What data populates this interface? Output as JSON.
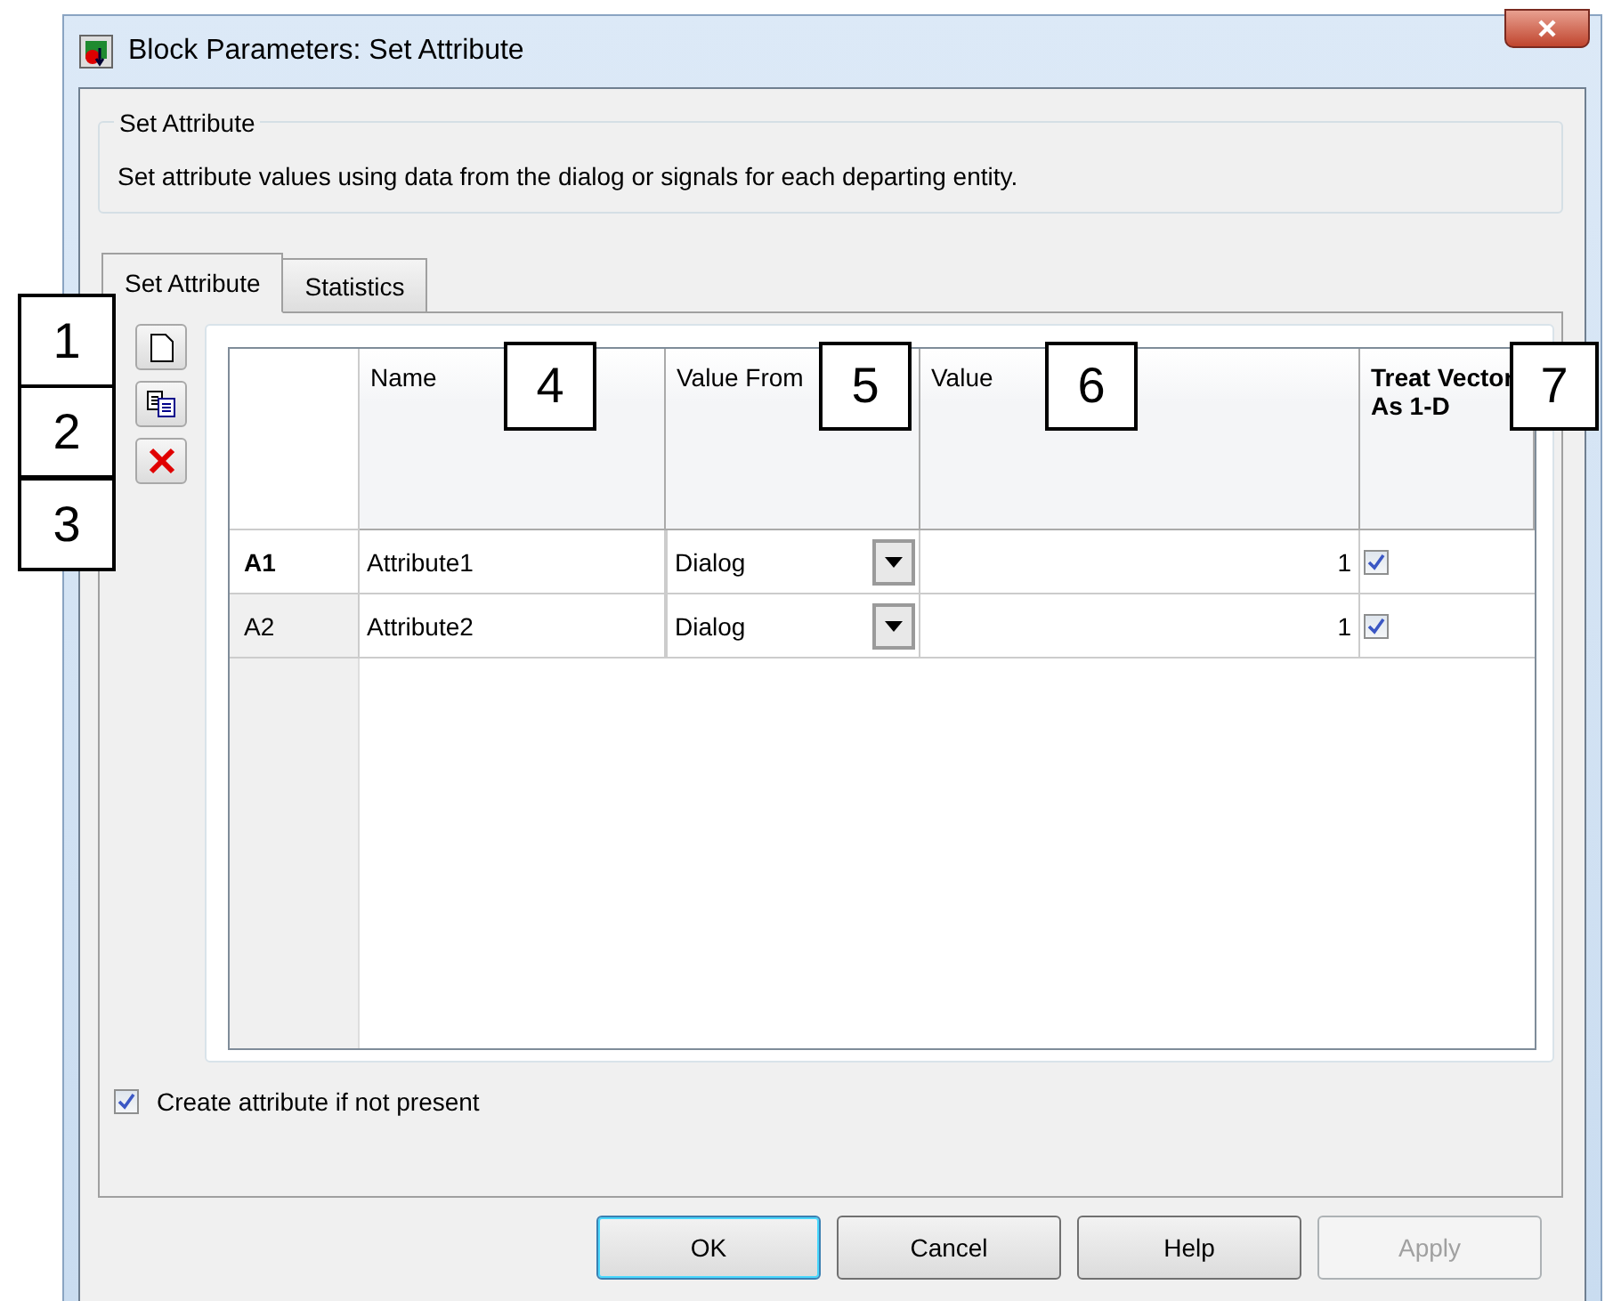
{
  "window": {
    "title": "Block Parameters: Set Attribute"
  },
  "group": {
    "title": "Set Attribute",
    "description": "Set attribute values using data from the dialog or signals for each departing entity."
  },
  "tabs": [
    {
      "label": "Set Attribute",
      "selected": true
    },
    {
      "label": "Statistics",
      "selected": false
    }
  ],
  "toolbar": [
    {
      "kind": "new"
    },
    {
      "kind": "copy"
    },
    {
      "kind": "delete"
    }
  ],
  "table": {
    "columns": [
      "Name",
      "Value From",
      "Value",
      "Treat Vector As 1-D"
    ],
    "rows": [
      {
        "header": "A1",
        "selected": true,
        "name": "Attribute1",
        "value_from": "Dialog",
        "value": "1",
        "treat_as_1d": true
      },
      {
        "header": "A2",
        "selected": false,
        "name": "Attribute2",
        "value_from": "Dialog",
        "value": "1",
        "treat_as_1d": true
      }
    ]
  },
  "create_if_missing": {
    "label": "Create attribute if not present",
    "checked": true
  },
  "buttons": [
    {
      "label": "OK",
      "default": true,
      "disabled": false
    },
    {
      "label": "Cancel",
      "default": false,
      "disabled": false
    },
    {
      "label": "Help",
      "default": false,
      "disabled": false
    },
    {
      "label": "Apply",
      "default": false,
      "disabled": true
    }
  ],
  "callouts": [
    "1",
    "2",
    "3",
    "4",
    "5",
    "6",
    "7"
  ]
}
